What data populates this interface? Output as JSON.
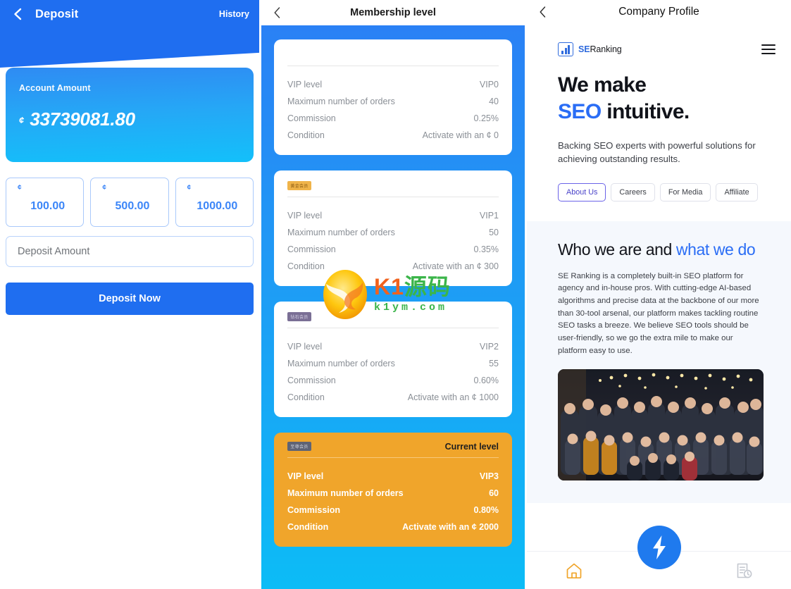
{
  "deposit": {
    "nav": {
      "back_icon": "chevron-left-icon",
      "title": "Deposit",
      "history_label": "History"
    },
    "account": {
      "label": "Account Amount",
      "currency": "¢",
      "amount": "33739081.80"
    },
    "quick_amounts": [
      {
        "currency": "¢",
        "value": "100.00"
      },
      {
        "currency": "¢",
        "value": "500.00"
      },
      {
        "currency": "¢",
        "value": "1000.00"
      }
    ],
    "amount_input": {
      "placeholder": "Deposit Amount",
      "value": ""
    },
    "submit_label": "Deposit Now",
    "colors": {
      "header": "#1f6ef0",
      "accent": "#3c86f8"
    }
  },
  "membership": {
    "nav": {
      "back_icon": "chevron-left-icon",
      "title": "Membership level"
    },
    "labels": {
      "vip_level": "VIP level",
      "max_orders": "Maximum number of orders",
      "commission": "Commission",
      "condition": "Condition"
    },
    "current_tag": "Current level",
    "cards": [
      {
        "badge": "",
        "badge_style": "badge-none",
        "is_current": false,
        "vip_level": "VIP0",
        "max_orders": "40",
        "commission": "0.25%",
        "condition": "Activate with an ¢ 0"
      },
      {
        "badge": "黄金会员",
        "badge_style": "badge-gold",
        "is_current": false,
        "vip_level": "VIP1",
        "max_orders": "50",
        "commission": "0.35%",
        "condition": "Activate with an ¢ 300"
      },
      {
        "badge": "钻石会员",
        "badge_style": "badge-plum",
        "is_current": false,
        "vip_level": "VIP2",
        "max_orders": "55",
        "commission": "0.60%",
        "condition": "Activate with an ¢ 1000"
      },
      {
        "badge": "至尊会员",
        "badge_style": "badge-slate",
        "is_current": true,
        "vip_level": "VIP3",
        "max_orders": "60",
        "commission": "0.80%",
        "condition": "Activate with an ¢ 2000"
      }
    ],
    "colors": {
      "bg_top": "#2b7ef5",
      "bg_bottom": "#0cbcf6",
      "current_card": "#f0a52b"
    }
  },
  "watermark": {
    "cn_text_1": "K1",
    "cn_text_2": "源码",
    "url": "k1ym.com"
  },
  "company": {
    "nav": {
      "back_icon": "chevron-left-icon",
      "title": "Company Profile"
    },
    "brand": {
      "se": "SE",
      "ranking": "Ranking",
      "logo_icon": "bar-chart-logo-icon",
      "menu_icon": "hamburger-menu-icon"
    },
    "hero": {
      "line1": "We make",
      "line2_blue": "SEO",
      "line2_rest": " intuitive.",
      "subtitle": "Backing SEO experts with powerful solutions for achieving outstanding results.",
      "tabs": [
        {
          "label": "About Us",
          "active": true
        },
        {
          "label": "Careers",
          "active": false
        },
        {
          "label": "For Media",
          "active": false
        },
        {
          "label": "Affiliate",
          "active": false
        }
      ]
    },
    "about": {
      "heading_black": "Who we are and ",
      "heading_blue": "what we do",
      "body": "SE Ranking is a completely built-in SEO platform for agency and in-house pros. With cutting-edge AI-based algorithms and precise data at the backbone of our more than 30-tool arsenal, our platform makes tackling routine SEO tasks a breeze. We believe SEO tools should be user-friendly, so we go the extra mile to make our platform easy to use.",
      "photo_alt": "team-group-photo"
    },
    "tabbar": {
      "home_icon": "home-icon",
      "fab_icon": "lightning-bolt-icon",
      "history_icon": "document-clock-icon"
    },
    "colors": {
      "blue": "#2a6df5",
      "section_bg": "#f5f8fd",
      "home_active": "#f0a52b"
    }
  }
}
